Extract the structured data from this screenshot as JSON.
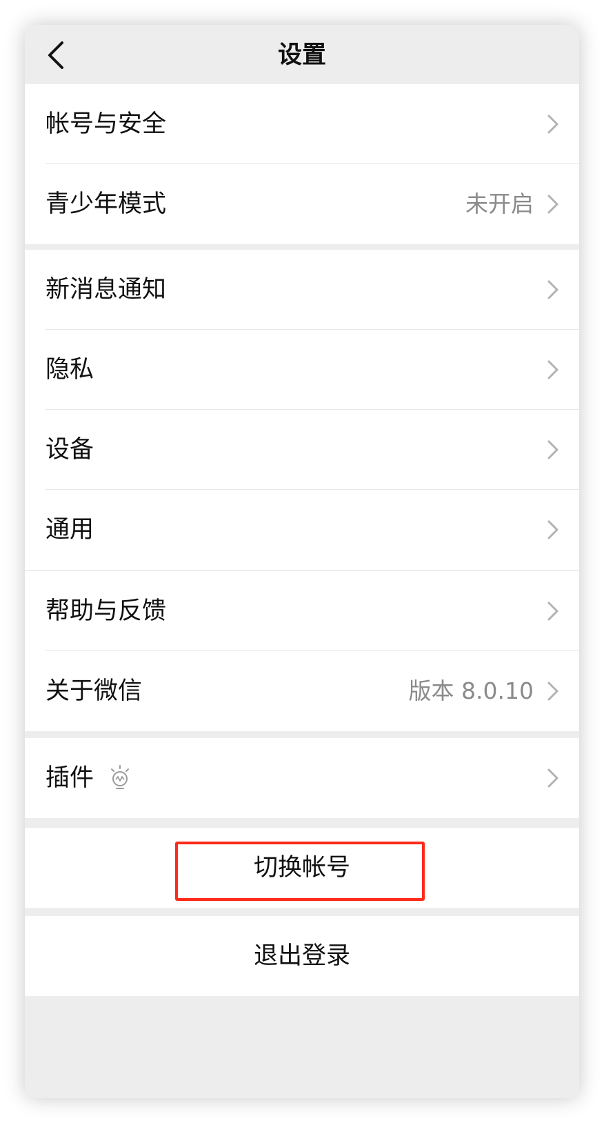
{
  "nav": {
    "title": "设置",
    "back_icon": "chevron-left-icon"
  },
  "groups": [
    {
      "items": [
        {
          "label": "帐号与安全",
          "value": ""
        },
        {
          "label": "青少年模式",
          "value": "未开启"
        }
      ]
    },
    {
      "items": [
        {
          "label": "新消息通知",
          "value": ""
        },
        {
          "label": "隐私",
          "value": ""
        },
        {
          "label": "设备",
          "value": ""
        },
        {
          "label": "通用",
          "value": ""
        }
      ]
    },
    {
      "items": [
        {
          "label": "帮助与反馈",
          "value": ""
        },
        {
          "label": "关于微信",
          "value": "版本 8.0.10"
        }
      ]
    },
    {
      "items": [
        {
          "label": "插件",
          "value": "",
          "icon": "lightbulb-icon"
        }
      ]
    }
  ],
  "actions": {
    "switch_account": "切换帐号",
    "logout": "退出登录"
  },
  "colors": {
    "background": "#ededed",
    "highlight": "#ff2a1a",
    "secondary_text": "#8a8a8a"
  }
}
